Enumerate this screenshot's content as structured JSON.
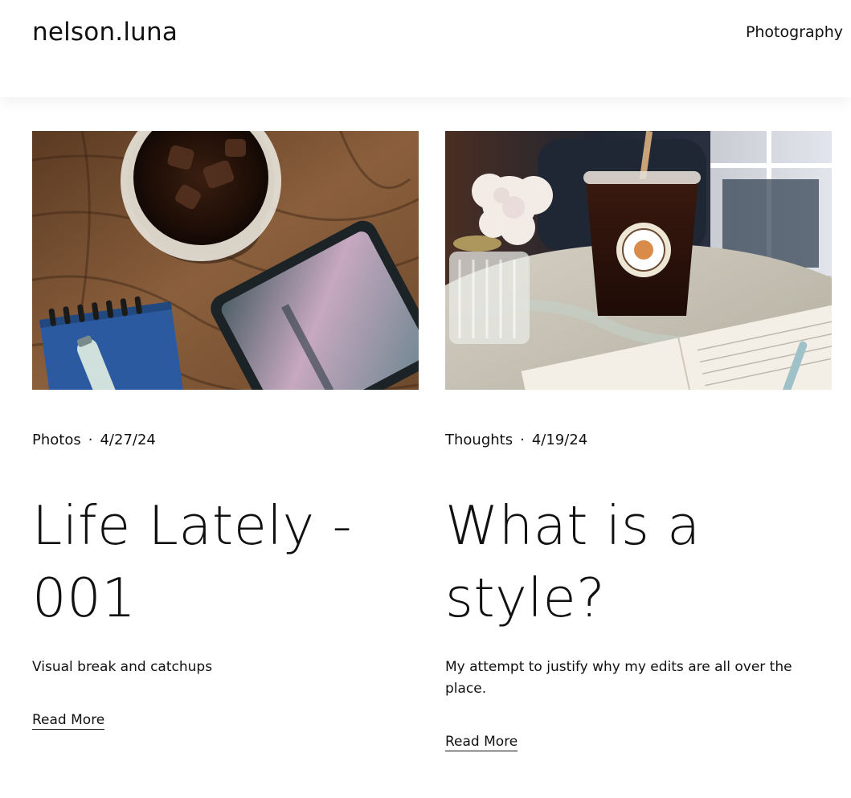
{
  "site": {
    "title": "nelson.luna",
    "nav": [
      {
        "label": "Photography"
      }
    ]
  },
  "posts": [
    {
      "category": "Photos",
      "separator": "·",
      "date": "4/27/24",
      "title": "Life Lately - 001",
      "excerpt": "Visual break and catchups",
      "read_more": "Read More",
      "image_icon": "iced-coffee-notebook-phone-photo"
    },
    {
      "category": "Thoughts",
      "separator": "·",
      "date": "4/19/24",
      "title": "What is a style?",
      "excerpt": "My attempt to justify why my edits are all over the place.",
      "read_more": "Read More",
      "image_icon": "iced-coffee-flower-journal-photo"
    }
  ],
  "colors": {
    "text": "#111111",
    "background": "#ffffff"
  }
}
